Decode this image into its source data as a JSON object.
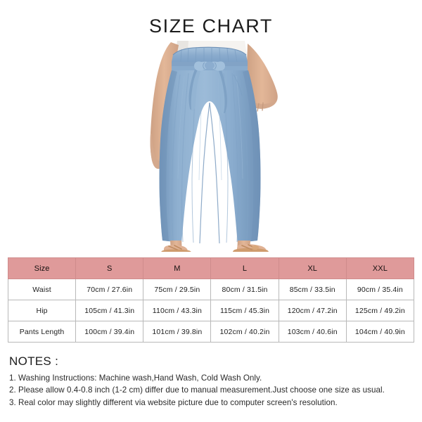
{
  "page": {
    "title": "SIZE CHART",
    "background_color": "#ffffff"
  },
  "photo": {
    "alt_name": "product-photo-wide-leg-pants",
    "description": "Woman wearing light blue paper-bag waist wide-leg pants with tie belt and tan sandals",
    "colors": {
      "fabric": "#7fa3c6",
      "fabric_light": "#9dbad7",
      "fabric_shadow": "#6e92b6",
      "skin": "#e0b295",
      "skin_shadow": "#caa084",
      "hair": "#6b5344",
      "top": "#f3f1ee",
      "sandal": "#cf9c6e"
    }
  },
  "table": {
    "header_color": "#df9a9a",
    "border_color": "#b9b9b9",
    "columns": [
      "Size",
      "S",
      "M",
      "L",
      "XL",
      "XXL"
    ],
    "rows": [
      {
        "label": "Waist",
        "values": [
          "70cm / 27.6in",
          "75cm / 29.5in",
          "80cm / 31.5in",
          "85cm / 33.5in",
          "90cm / 35.4in"
        ]
      },
      {
        "label": "Hip",
        "values": [
          "105cm / 41.3in",
          "110cm / 43.3in",
          "115cm / 45.3in",
          "120cm / 47.2in",
          "125cm / 49.2in"
        ]
      },
      {
        "label": "Pants Length",
        "values": [
          "100cm / 39.4in",
          "101cm / 39.8in",
          "102cm / 40.2in",
          "103cm / 40.6in",
          "104cm / 40.9in"
        ]
      }
    ]
  },
  "notes": {
    "heading": "NOTES :",
    "lines": [
      "1. Washing Instructions: Machine wash,Hand Wash, Cold Wash Only.",
      "2. Please allow 0.4-0.8 inch (1-2 cm) differ due to manual measurement.Just choose one size as usual.",
      "3. Real color may slightly different via website picture due to computer screen's resolution."
    ]
  }
}
